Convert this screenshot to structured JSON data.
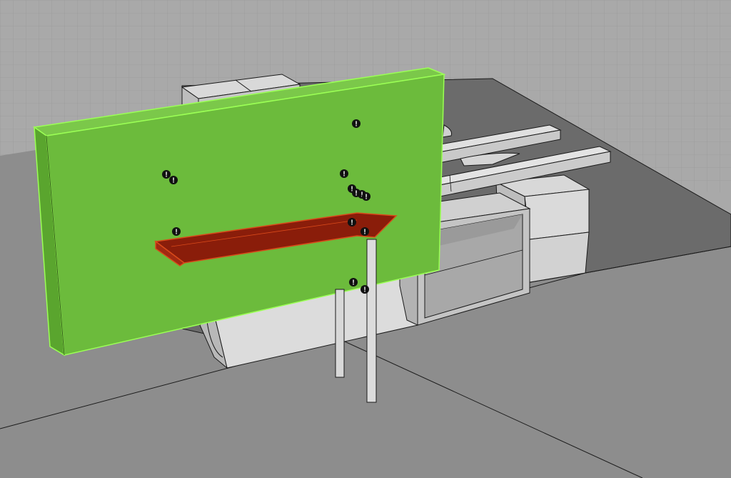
{
  "viewport": {
    "view": "perspective",
    "colors": {
      "sky": "#a9a9a9",
      "grid_line": "#9a9a9a",
      "ground": "#8d8d8d",
      "base_slab": "#6b6b6b",
      "object_light": "#dcdcdc",
      "object_mid": "#c8c8c8",
      "object_dark": "#b0b0b0",
      "edge": "#1a1a1a",
      "green_panel": "#6cbb3c",
      "green_panel_side": "#5aa52e",
      "green_highlight": "#9bff55",
      "red_shelf": "#8a1d0a",
      "red_shelf_edge": "#d94a1a",
      "marker": "#111111",
      "marker_glyph": "#ffffff"
    },
    "markers": [
      {
        "id": "marker-1",
        "glyph": "!"
      },
      {
        "id": "marker-2",
        "glyph": "!"
      },
      {
        "id": "marker-3",
        "glyph": "!"
      },
      {
        "id": "marker-4",
        "glyph": "!"
      },
      {
        "id": "marker-5",
        "glyph": "!"
      },
      {
        "id": "marker-6",
        "glyph": "!"
      },
      {
        "id": "marker-7",
        "glyph": "!"
      },
      {
        "id": "marker-8",
        "glyph": "!"
      },
      {
        "id": "marker-9",
        "glyph": "!"
      },
      {
        "id": "marker-10",
        "glyph": "!"
      },
      {
        "id": "marker-11",
        "glyph": "!"
      },
      {
        "id": "marker-12",
        "glyph": "!"
      },
      {
        "id": "marker-13",
        "glyph": "!"
      }
    ]
  }
}
